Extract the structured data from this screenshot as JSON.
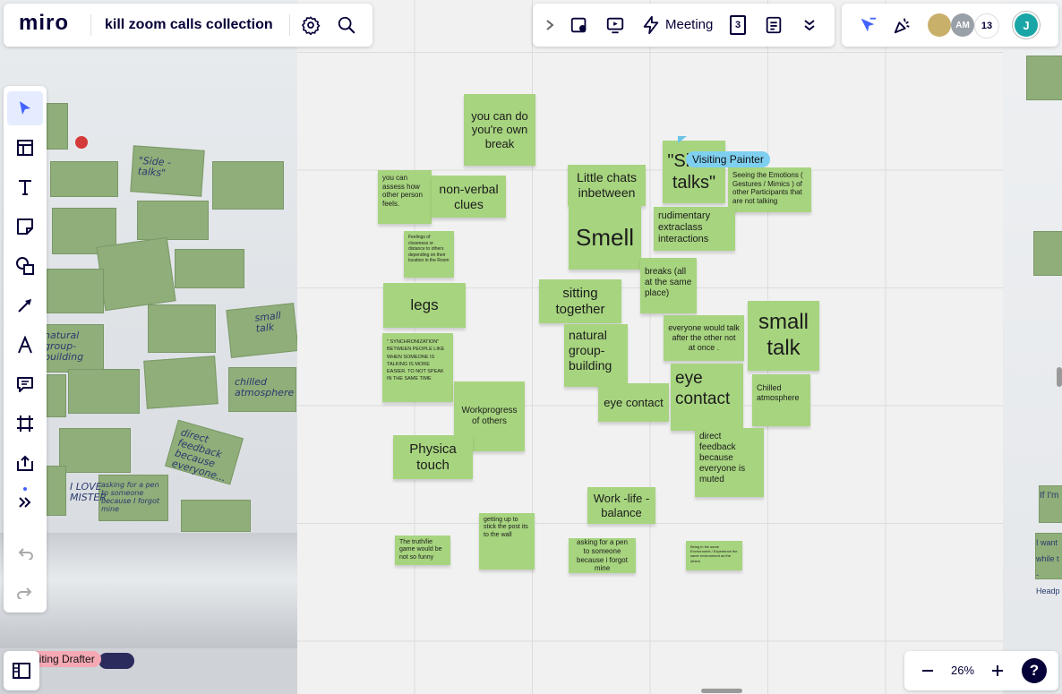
{
  "app": {
    "logo": "miro",
    "board_title": "kill zoom calls collection"
  },
  "top_toolbar": {
    "meeting_label": "Meeting",
    "timer_digit": "3"
  },
  "collaborators": {
    "avatar_initials": "AM",
    "count": "13",
    "current_user_initial": "J"
  },
  "cursors": {
    "painter_label": "Visiting Painter",
    "drafter_label": "isiting Drafter",
    "drafter_color": "#f4a9b5",
    "painter_color": "#7fd0f0"
  },
  "zoom": {
    "level": "26%"
  },
  "help": {
    "label": "?"
  },
  "colors": {
    "sticky": "#a7d47f",
    "accent": "#4262ff",
    "brand": "#050038"
  },
  "photo_texts": [
    "\"Side - talks\"",
    "natural group-building",
    "small talk",
    "chilled atmosphere",
    "direct feedback because everyone...",
    "I LOVE MISTER",
    "asking for a pen to someone because I forgot mine",
    "If I'm",
    "I want while t - Headp"
  ],
  "notes": [
    {
      "text": "you can do you're own break"
    },
    {
      "text": "Little chats inbetween"
    },
    {
      "text": "\"Side - talks\""
    },
    {
      "text": "Seeing the Emotions ( Gestures / Mimics ) of other Participants that are not talking"
    },
    {
      "text": "you can assess how other person feels."
    },
    {
      "text": "non-verbal clues"
    },
    {
      "text": "Smell"
    },
    {
      "text": "rudimentary extraclass interactions"
    },
    {
      "text": "Feelings of closeness or distance to others depending on their location in the Room"
    },
    {
      "text": "legs"
    },
    {
      "text": "sitting together"
    },
    {
      "text": "breaks (all at the same place)"
    },
    {
      "text": "small talk"
    },
    {
      "text": "everyone would talk after the other not at once ."
    },
    {
      "text": "natural group-building"
    },
    {
      "text": "\" SYNCHRONIZATION\" BETWEEN PEOPLE LIKE WHEN SOMEONE IS TALKING IS MORE EASIER. TO NOT SPEAK IN THE SAME TIME"
    },
    {
      "text": "eye contact"
    },
    {
      "text": "eye contact"
    },
    {
      "text": "Chilled atmosphere"
    },
    {
      "text": "Workprogress of others"
    },
    {
      "text": "direct feedback because everyone is muted"
    },
    {
      "text": "Physica touch"
    },
    {
      "text": "Work -life - balance"
    },
    {
      "text": "The truth/lie game would be not so funny"
    },
    {
      "text": "getting up to stick the post its to the wall"
    },
    {
      "text": "asking for a pen to someone because i forgot mine"
    },
    {
      "text": "Being in the same Environment / Experience the same environment as the others"
    }
  ]
}
